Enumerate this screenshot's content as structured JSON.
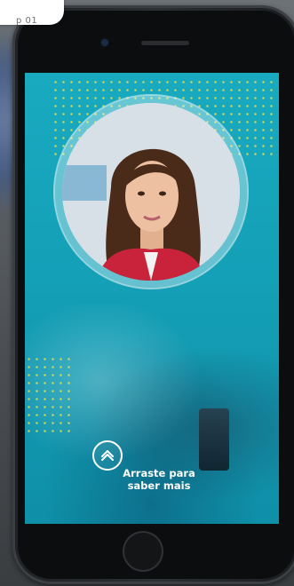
{
  "step": {
    "label": "p 01"
  },
  "cta": {
    "icon": "chevron-up-icon",
    "line1": "Arraste para",
    "line2": "saber mais"
  },
  "colors": {
    "screen_bg": "#14a0b7",
    "dot_accent": "#f0e04a",
    "text": "#ffffff"
  }
}
